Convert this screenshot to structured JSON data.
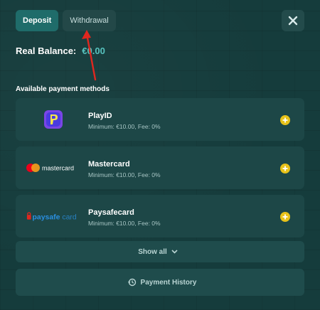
{
  "tabs": {
    "deposit": "Deposit",
    "withdrawal": "Withdrawal"
  },
  "balance": {
    "label": "Real Balance:",
    "amount": "€0.00"
  },
  "section_title": "Available payment methods",
  "methods": [
    {
      "name": "PlayID",
      "limits": "Minimum: €10.00, Fee: 0%",
      "logo": "playid-logo"
    },
    {
      "name": "Mastercard",
      "limits": "Minimum: €10.00, Fee: 0%",
      "logo": "mastercard-logo",
      "logo_text": "mastercard"
    },
    {
      "name": "Paysafecard",
      "limits": "Minimum: €10.00, Fee: 0%",
      "logo": "paysafecard-logo",
      "logo_text_a": "paysafe",
      "logo_text_b": "card"
    }
  ],
  "show_all": "Show all",
  "history": "Payment History",
  "colors": {
    "accent": "#1f6c6a",
    "add_button": "#e7c21a",
    "balance_amount": "#57c3bf",
    "arrow": "#e0271f"
  }
}
